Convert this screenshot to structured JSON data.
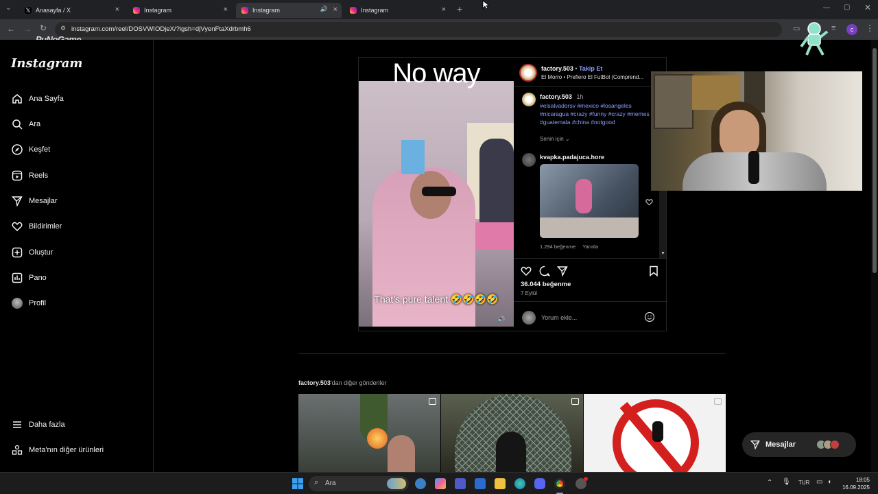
{
  "tabs": [
    {
      "title": "Anasayfa / X",
      "icon": "x-logo-icon"
    },
    {
      "title": "Instagram",
      "icon": "instagram-icon"
    },
    {
      "title": "Instagram",
      "icon": "instagram-icon",
      "active": true,
      "audio": true
    },
    {
      "title": "Instagram",
      "icon": "instagram-icon"
    }
  ],
  "address": {
    "url": "instagram.com/reel/DOSVWIODjeX/?igsh=djVyenFtaXdrbmh6"
  },
  "overlay_logo": "PuNoGame",
  "sidebar": {
    "logo": "Instagram",
    "items": [
      {
        "label": "Ana Sayfa",
        "icon": "home-icon"
      },
      {
        "label": "Ara",
        "icon": "search-icon"
      },
      {
        "label": "Keşfet",
        "icon": "compass-icon"
      },
      {
        "label": "Reels",
        "icon": "reels-icon"
      },
      {
        "label": "Mesajlar",
        "icon": "messenger-icon"
      },
      {
        "label": "Bildirimler",
        "icon": "heart-icon"
      },
      {
        "label": "Oluştur",
        "icon": "plus-square-icon"
      },
      {
        "label": "Pano",
        "icon": "dashboard-icon"
      },
      {
        "label": "Profil",
        "icon": "avatar-icon"
      }
    ],
    "more": "Daha fazla",
    "meta": "Meta'nın diğer ürünleri"
  },
  "video": {
    "top_text": "No way",
    "caption": "That's pure talent 🤣🤣🤣🤣"
  },
  "post": {
    "username": "factory.503",
    "follow": "Takip Et",
    "separator": "•",
    "audio": "El Morro • Prefiero El FutBol (Comprend...",
    "caption_user": "factory.503",
    "caption_time": "1h",
    "hashtags": "#elsalvadorsv #mexico #losangeles #nicaragua #crazy #funny #crazy #memes #guatemala #china #notgood",
    "for_you": "Senin için",
    "comment_user": "kvapka.padajuca.hore",
    "comment_likes": "1.294 beğenme",
    "comment_reply": "Yanıtla",
    "likes": "36.044 beğenme",
    "date": "7 Eylül",
    "comment_placeholder": "Yorum ekle..."
  },
  "more_posts": {
    "user": "factory.503",
    "suffix": "'dan diğer gönderiler"
  },
  "messages_pill": {
    "label": "Mesajlar"
  },
  "taskbar": {
    "search": "Ara",
    "lang": "TUR",
    "time": "18:05",
    "date": "16.09.2025"
  },
  "colors": {
    "accent": "#8c9dff",
    "bg": "#000000",
    "follow": "#8c9dff"
  }
}
